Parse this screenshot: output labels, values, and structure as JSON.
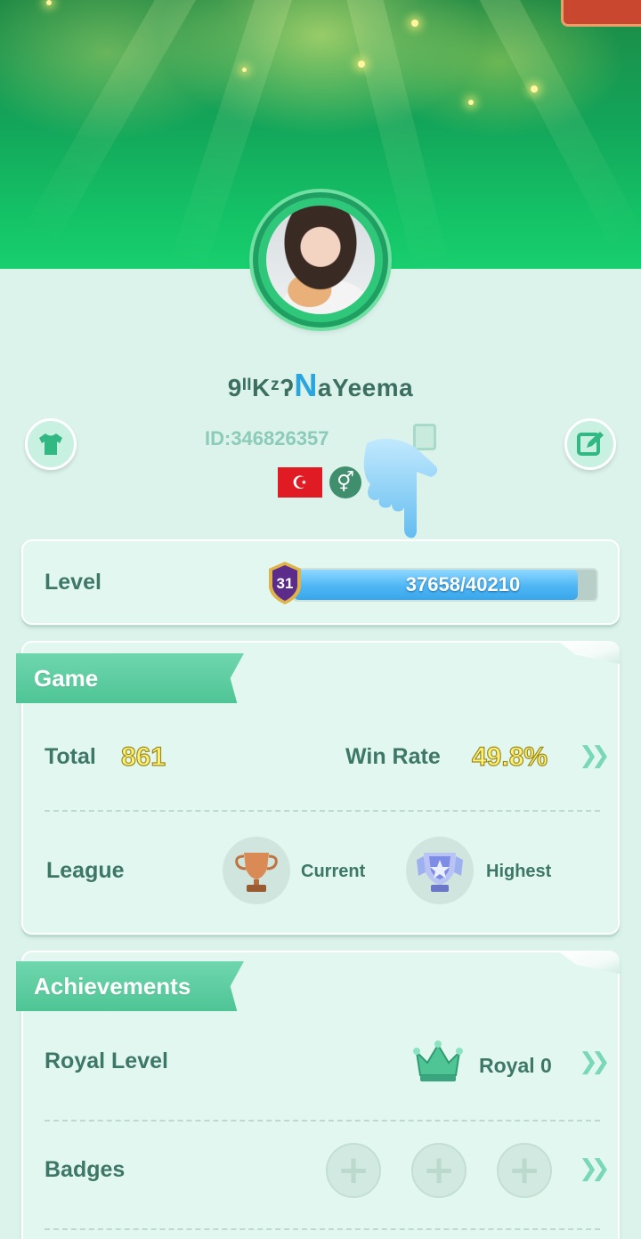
{
  "profile": {
    "name_prefix": "9ᴵᴵKᶻ",
    "name_mark": "ʔ",
    "name_big_letter": "N",
    "name_rest": "aYeema",
    "id_text": "ID:346826357",
    "country_flag": "turkey-flag",
    "gender_symbol": "⚥"
  },
  "level": {
    "label": "Level",
    "badge_number": "31",
    "progress_text": "37658/40210",
    "progress_fraction": 0.937
  },
  "game": {
    "section_title": "Game",
    "total_label": "Total",
    "total_value": "861",
    "winrate_label": "Win Rate",
    "winrate_value": "49.8%",
    "league_label": "League",
    "current_label": "Current",
    "highest_label": "Highest"
  },
  "achievements": {
    "section_title": "Achievements",
    "royal_label": "Royal Level",
    "royal_value": "Royal 0",
    "badges_label": "Badges",
    "badge_slots": 3
  },
  "colors": {
    "accent_green": "#4fc596",
    "level_bar_blue": "#4eb6f4",
    "highlight_yellow": "#fff176"
  }
}
